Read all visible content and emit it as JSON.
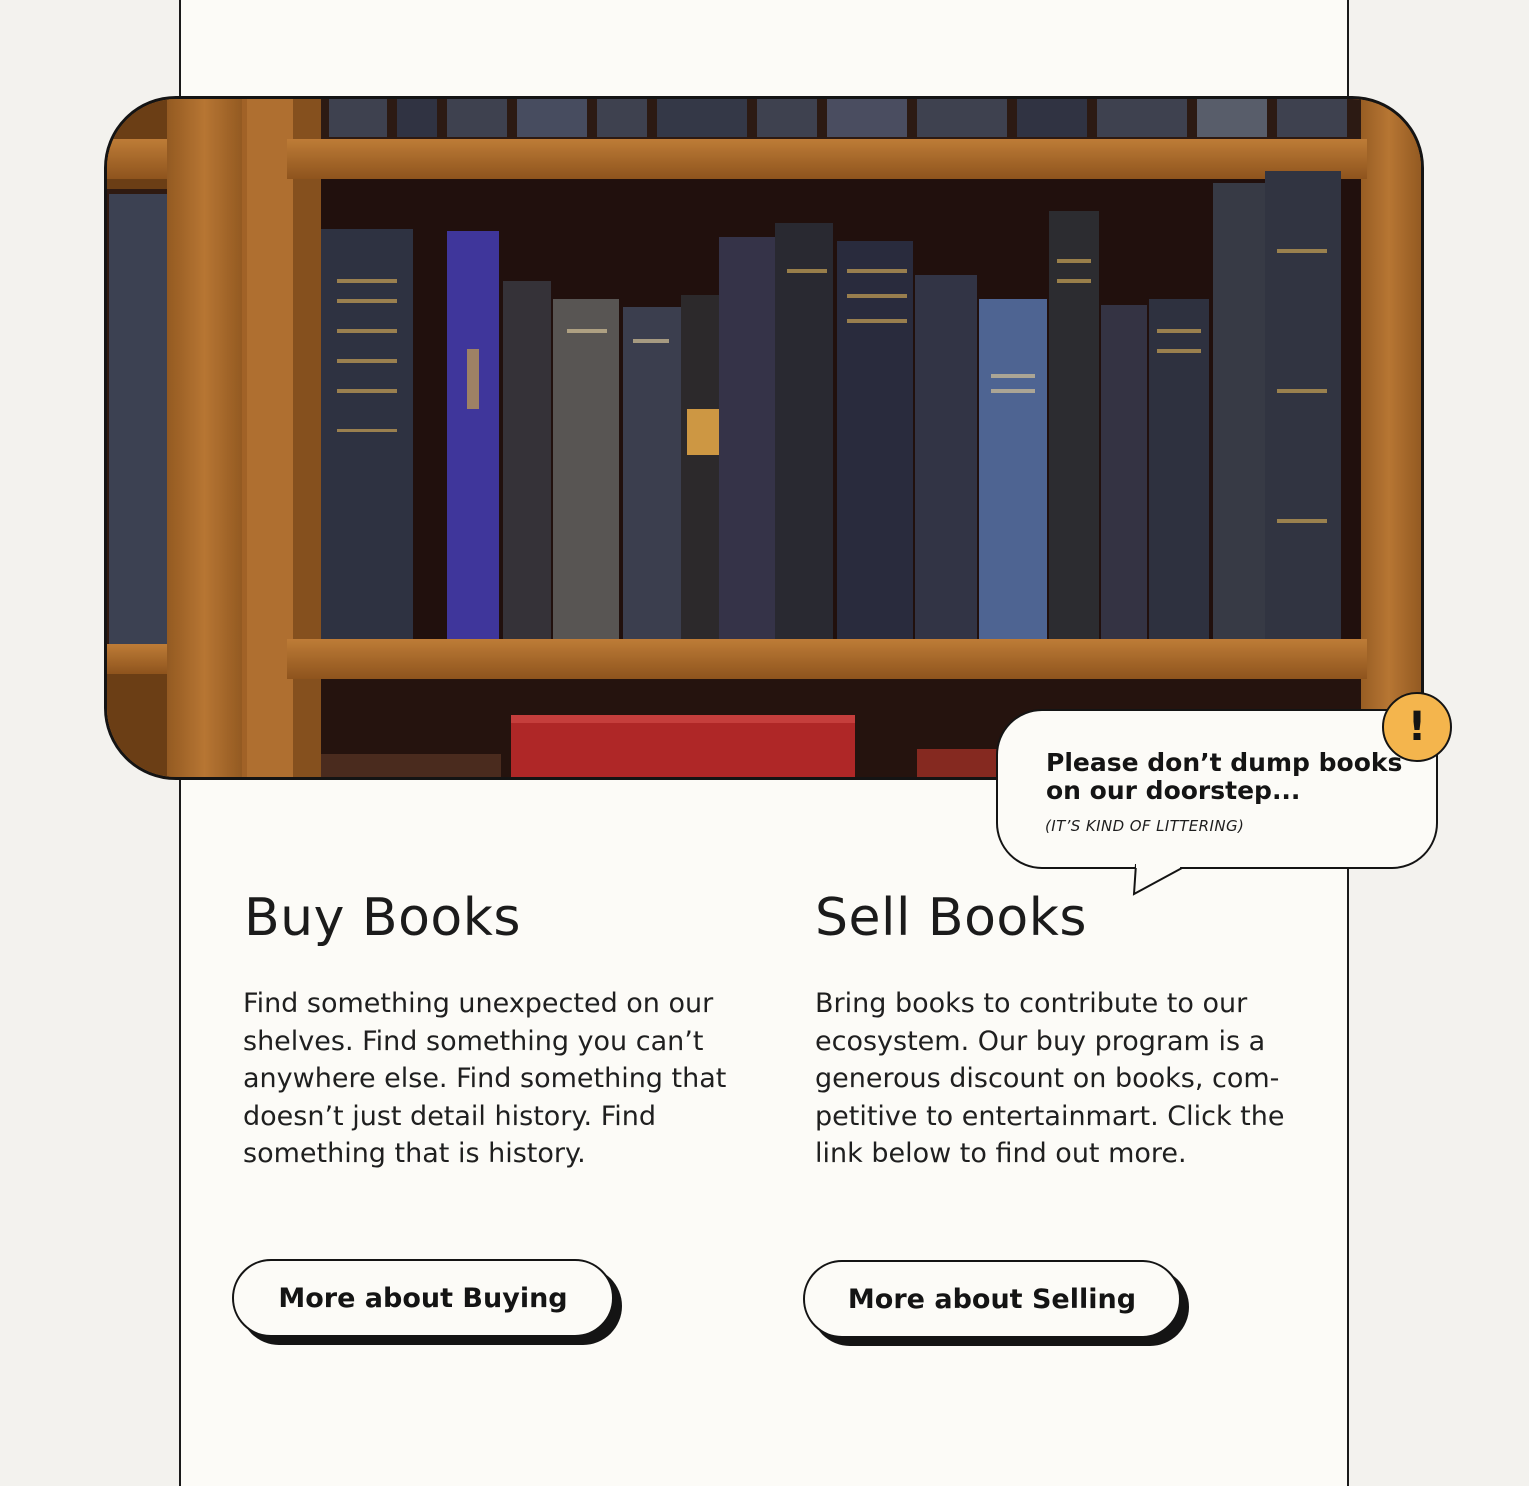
{
  "hero": {
    "alt": "Bookshelf with vintage hardcover books"
  },
  "notice": {
    "title": "Please don’t dump books on our doorstep...",
    "subtitle": "(IT’S KIND OF LITTERING)",
    "badge": "!",
    "badge_color": "#f4b54d"
  },
  "buy": {
    "title": "Buy Books",
    "text": "Find something unexpected on our shelves. Find something you can’t anywhere else. Find something that doesn’t just detail history. Find something that is history.",
    "button_label": "More about Buying"
  },
  "sell": {
    "title": "Sell Books",
    "text": "Bring books to contribute to our ecosystem. Our buy program is a generous discount on books, com-petitive to entertainmart. Click the link below to find out more.",
    "button_label": "More about Selling"
  },
  "colors": {
    "page_background": "#fcfbf7",
    "outer_background": "#f3f2ee",
    "ink": "#141414",
    "shelf_wood": "#b5742e"
  }
}
